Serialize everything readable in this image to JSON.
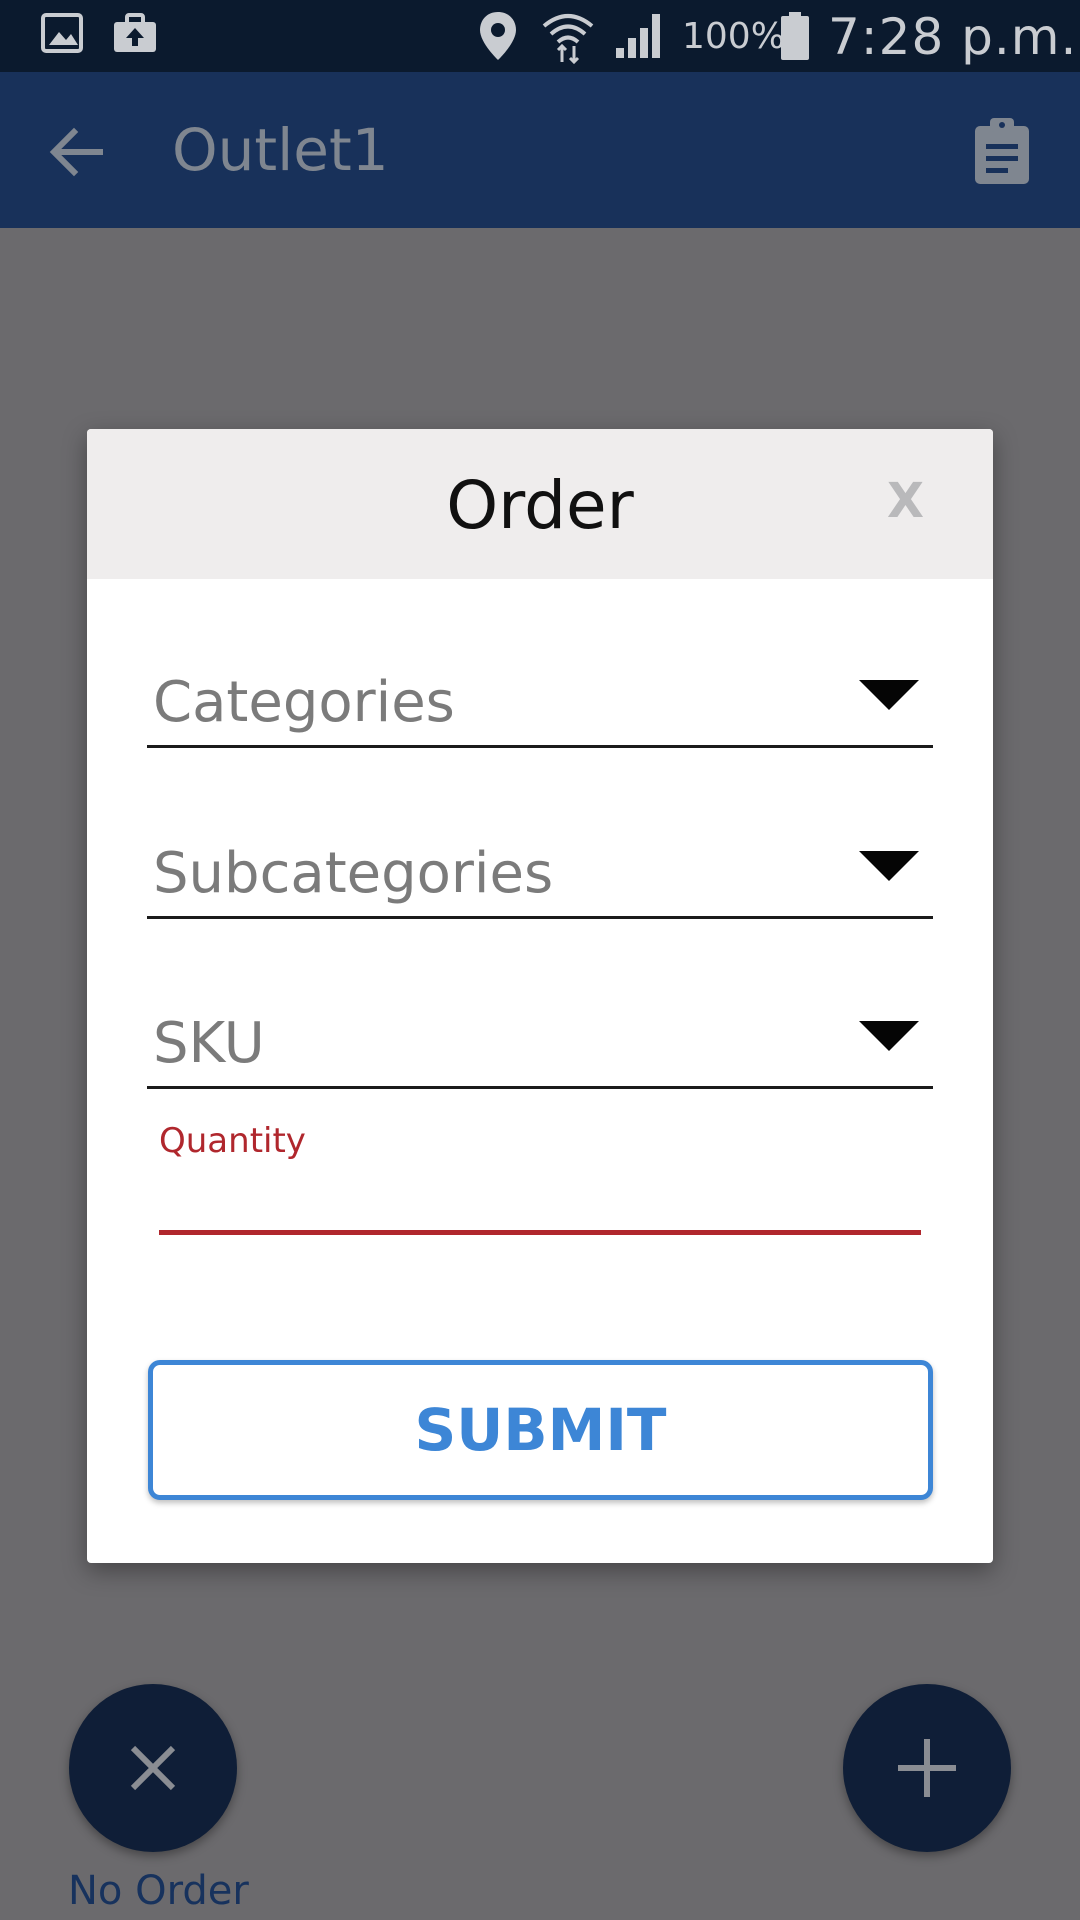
{
  "status_bar": {
    "battery_percent": "100%",
    "time": "7:28 p.m.",
    "icons": [
      "gallery-icon",
      "briefcase-upload-icon",
      "location-icon",
      "wifi-icon",
      "signal-icon",
      "battery-icon"
    ]
  },
  "app_bar": {
    "title": "Outlet1",
    "back_icon": "arrow-back-icon",
    "action_icon": "clipboard-icon"
  },
  "dialog": {
    "title": "Order",
    "close_label": "X",
    "fields": {
      "categories": "Categories",
      "subcategories": "Subcategories",
      "sku": "SKU"
    },
    "quantity": {
      "label": "Quantity",
      "value": ""
    },
    "submit_label": "SUBMIT"
  },
  "fabs": {
    "no_order_label": "No Order",
    "no_order_icon": "close-icon",
    "add_icon": "plus-icon"
  },
  "colors": {
    "status_bar": "#0b1a2e",
    "app_bar": "#18315a",
    "accent_blue": "#3d86d6",
    "error_red": "#b0272d",
    "fab": "#0f1e37"
  }
}
